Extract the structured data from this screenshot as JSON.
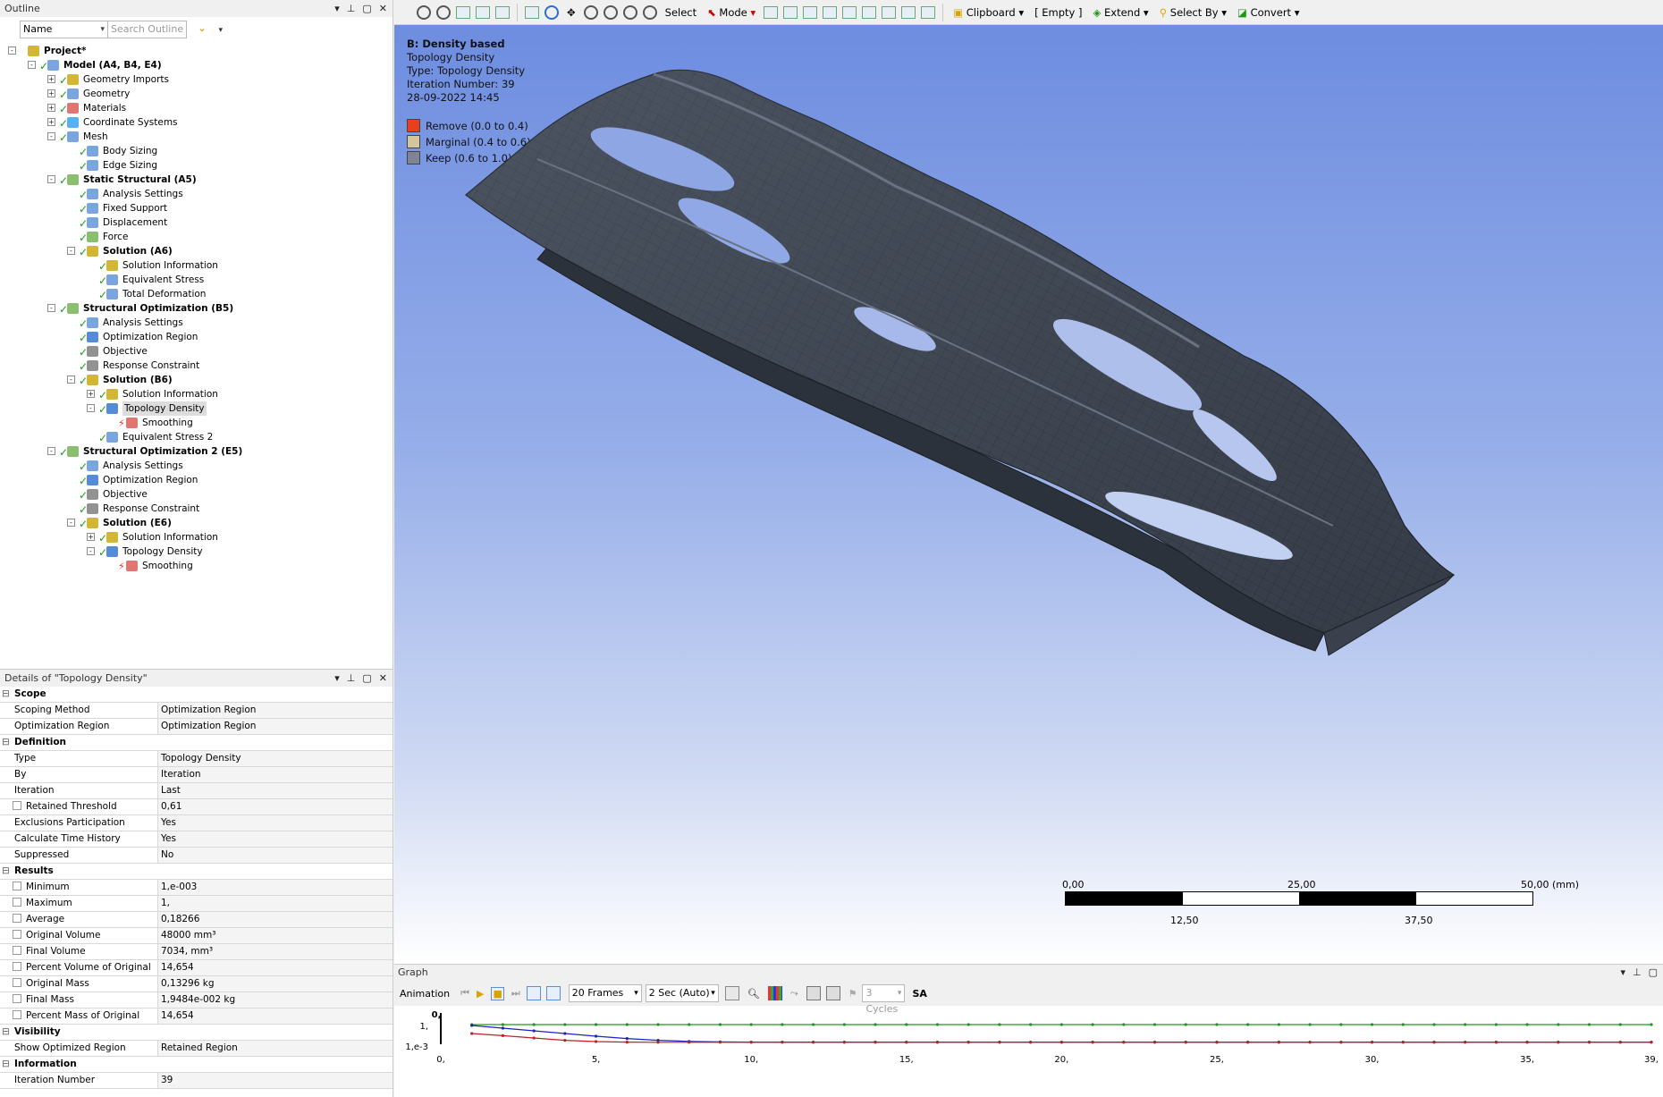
{
  "outline": {
    "title": "Outline",
    "filter_select": "Name",
    "search_placeholder": "Search Outline",
    "tree": [
      {
        "label": "Project*",
        "bold": true,
        "level": 0
      },
      {
        "label": "Model (A4, B4, E4)",
        "bold": true,
        "level": 1
      },
      {
        "label": "Geometry Imports",
        "level": 2
      },
      {
        "label": "Geometry",
        "level": 2
      },
      {
        "label": "Materials",
        "level": 2
      },
      {
        "label": "Coordinate Systems",
        "level": 2
      },
      {
        "label": "Mesh",
        "level": 2
      },
      {
        "label": "Body Sizing",
        "level": 3
      },
      {
        "label": "Edge Sizing",
        "level": 3
      },
      {
        "label": "Static Structural (A5)",
        "bold": true,
        "level": 2
      },
      {
        "label": "Analysis Settings",
        "level": 3
      },
      {
        "label": "Fixed Support",
        "level": 3
      },
      {
        "label": "Displacement",
        "level": 3
      },
      {
        "label": "Force",
        "level": 3
      },
      {
        "label": "Solution (A6)",
        "bold": true,
        "level": 3
      },
      {
        "label": "Solution Information",
        "level": 4
      },
      {
        "label": "Equivalent Stress",
        "level": 4
      },
      {
        "label": "Total Deformation",
        "level": 4
      },
      {
        "label": "Structural Optimization (B5)",
        "bold": true,
        "level": 2
      },
      {
        "label": "Analysis Settings",
        "level": 3
      },
      {
        "label": "Optimization Region",
        "level": 3
      },
      {
        "label": "Objective",
        "level": 3
      },
      {
        "label": "Response Constraint",
        "level": 3
      },
      {
        "label": "Solution (B6)",
        "bold": true,
        "level": 3
      },
      {
        "label": "Solution Information",
        "level": 4
      },
      {
        "label": "Topology Density",
        "level": 4
      },
      {
        "label": "Smoothing",
        "level": 5
      },
      {
        "label": "Equivalent Stress 2",
        "level": 4
      },
      {
        "label": "Structural Optimization 2 (E5)",
        "bold": true,
        "level": 2
      },
      {
        "label": "Analysis Settings",
        "level": 3
      },
      {
        "label": "Optimization Region",
        "level": 3
      },
      {
        "label": "Objective",
        "level": 3
      },
      {
        "label": "Response Constraint",
        "level": 3
      },
      {
        "label": "Solution (E6)",
        "bold": true,
        "level": 3
      },
      {
        "label": "Solution Information",
        "level": 4
      },
      {
        "label": "Topology Density",
        "level": 4
      },
      {
        "label": "Smoothing",
        "level": 5
      }
    ]
  },
  "details": {
    "title": "Details of \"Topology Density\"",
    "rows": [
      {
        "group": "Scope"
      },
      {
        "k": "Scoping Method",
        "v": "Optimization Region"
      },
      {
        "k": "Optimization Region",
        "v": "Optimization Region"
      },
      {
        "group": "Definition"
      },
      {
        "k": "Type",
        "v": "Topology Density"
      },
      {
        "k": "By",
        "v": "Iteration"
      },
      {
        "k": "Iteration",
        "v": "Last"
      },
      {
        "k": "Retained Threshold",
        "v": "0,61",
        "cb": true
      },
      {
        "k": "Exclusions Participation",
        "v": "Yes"
      },
      {
        "k": "Calculate Time History",
        "v": "Yes"
      },
      {
        "k": "Suppressed",
        "v": "No"
      },
      {
        "group": "Results"
      },
      {
        "k": "Minimum",
        "v": "1,e-003",
        "cb": true
      },
      {
        "k": "Maximum",
        "v": "1,",
        "cb": true
      },
      {
        "k": "Average",
        "v": "0,18266",
        "cb": true
      },
      {
        "k": "Original Volume",
        "v": "48000 mm³",
        "cb": true
      },
      {
        "k": "Final Volume",
        "v": "7034, mm³",
        "cb": true
      },
      {
        "k": "Percent Volume of Original",
        "v": "14,654",
        "cb": true
      },
      {
        "k": "Original Mass",
        "v": "0,13296 kg",
        "cb": true
      },
      {
        "k": "Final Mass",
        "v": "1,9484e-002 kg",
        "cb": true
      },
      {
        "k": "Percent Mass of Original",
        "v": "14,654",
        "cb": true
      },
      {
        "group": "Visibility"
      },
      {
        "k": "Show Optimized Region",
        "v": "Retained Region"
      },
      {
        "group": "Information"
      },
      {
        "k": "Iteration Number",
        "v": "39"
      }
    ]
  },
  "toolbar": {
    "select": "Select",
    "mode": "Mode",
    "clipboard": "Clipboard",
    "empty": "[ Empty ]",
    "extend": "Extend",
    "select_by": "Select By",
    "convert": "Convert"
  },
  "viewport": {
    "result_title": "B: Density based",
    "result_type_line1": "Topology Density",
    "result_type_line2": "Type: Topology Density",
    "iteration_line": "Iteration Number: 39",
    "date_line": "28-09-2022 14:45",
    "legend": [
      {
        "label": "Remove (0.0 to 0.4)",
        "color": "#e8401c"
      },
      {
        "label": "Marginal (0.4 to 0.6)",
        "color": "#d4c59a"
      },
      {
        "label": "Keep (0.6 to 1.0)",
        "color": "#7e8592"
      }
    ],
    "scale": {
      "top": [
        "0,00",
        "25,00",
        "50,00 (mm)"
      ],
      "bottom": [
        "12,50",
        "37,50"
      ]
    }
  },
  "graph": {
    "title": "Graph",
    "animation_label": "Animation",
    "frames": "20 Frames",
    "duration": "2 Sec (Auto)",
    "cycles": "3 Cycles",
    "sa": "SA",
    "y_labels": [
      "0,",
      "1,",
      "1,e-3"
    ],
    "x_labels": [
      "0,",
      "5,",
      "10,",
      "15,",
      "20,",
      "25,",
      "30,",
      "35,",
      "39,"
    ]
  },
  "chart_data": {
    "type": "line",
    "x": [
      1,
      2,
      3,
      4,
      5,
      6,
      7,
      8,
      9,
      10,
      11,
      12,
      13,
      14,
      15,
      16,
      17,
      18,
      19,
      20,
      21,
      22,
      23,
      24,
      25,
      26,
      27,
      28,
      29,
      30,
      31,
      32,
      33,
      34,
      35,
      36,
      37,
      38,
      39
    ],
    "series": [
      {
        "color": "#1a9a1a",
        "values": [
          1,
          1,
          1,
          1,
          1,
          1,
          1,
          1,
          1,
          1,
          1,
          1,
          1,
          1,
          1,
          1,
          1,
          1,
          1,
          1,
          1,
          1,
          1,
          1,
          1,
          1,
          1,
          1,
          1,
          1,
          1,
          1,
          1,
          1,
          1,
          1,
          1,
          1,
          1
        ]
      },
      {
        "color": "#2020c0",
        "values": [
          0.95,
          0.8,
          0.65,
          0.5,
          0.35,
          0.22,
          0.12,
          0.06,
          0.03,
          0.02,
          0.02,
          0.02,
          0.02,
          0.02,
          0.02,
          0.02,
          0.02,
          0.02,
          0.02,
          0.02,
          0.02,
          0.02,
          0.02,
          0.02,
          0.02,
          0.02,
          0.02,
          0.02,
          0.02,
          0.02,
          0.02,
          0.02,
          0.02,
          0.02,
          0.02,
          0.02,
          0.02,
          0.02,
          0.02
        ]
      },
      {
        "color": "#c02020",
        "values": [
          0.5,
          0.38,
          0.25,
          0.12,
          0.05,
          0.02,
          0.01,
          0.01,
          0.01,
          0.01,
          0.01,
          0.01,
          0.01,
          0.01,
          0.01,
          0.01,
          0.01,
          0.01,
          0.01,
          0.01,
          0.01,
          0.01,
          0.01,
          0.01,
          0.01,
          0.01,
          0.01,
          0.01,
          0.01,
          0.01,
          0.01,
          0.01,
          0.01,
          0.01,
          0.01,
          0.01,
          0.01,
          0.01,
          0.01
        ]
      }
    ],
    "xlim": [
      0,
      39
    ]
  }
}
